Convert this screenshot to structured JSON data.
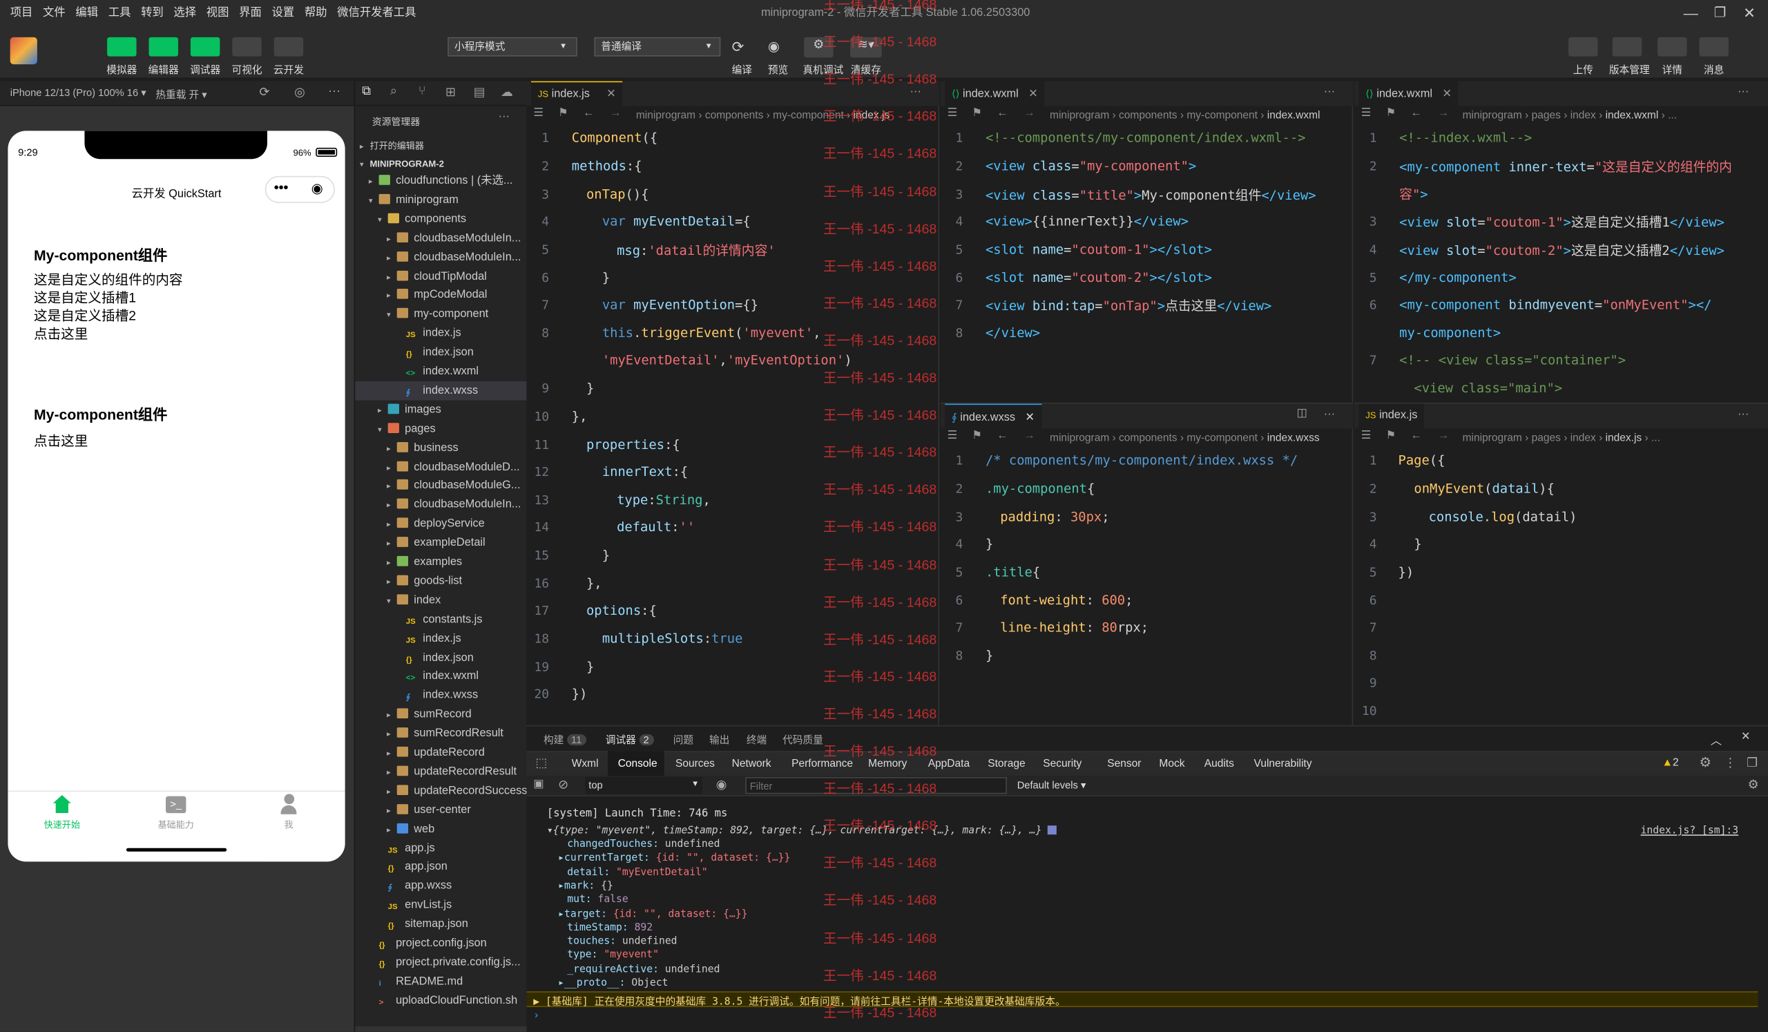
{
  "menu": [
    "项目",
    "文件",
    "编辑",
    "工具",
    "转到",
    "选择",
    "视图",
    "界面",
    "设置",
    "帮助",
    "微信开发者工具"
  ],
  "window_title": "miniprogram-2 - 微信开发者工具 Stable 1.06.2503300",
  "toolbar": {
    "left_buttons": [
      "模拟器",
      "编辑器",
      "调试器",
      "可视化",
      "云开发"
    ],
    "mode_select": "小程序模式",
    "compile_select": "普通编译",
    "mid_buttons": [
      "编译",
      "预览",
      "真机调试",
      "清缓存"
    ],
    "right_buttons": [
      "上传",
      "版本管理",
      "详情",
      "消息"
    ]
  },
  "simbar": {
    "device": "iPhone 12/13 (Pro) 100% 16 ▾",
    "hotreload": "热重载 开 ▾"
  },
  "phone": {
    "time": "9:29",
    "battery": "96%",
    "nav_title": "云开发 QuickStart",
    "block1_title": "My-component组件",
    "block1_lines": [
      "这是自定义的组件的内容",
      "这是自定义插槽1",
      "这是自定义插槽2",
      "点击这里"
    ],
    "block2_title": "My-component组件",
    "block2_lines": [
      "点击这里"
    ],
    "tabbar": [
      "快速开始",
      "基础能力",
      "我"
    ]
  },
  "explorer": {
    "header": "资源管理器",
    "open_editors": "打开的编辑器",
    "project": "MINIPROGRAM-2",
    "items": [
      {
        "label": "cloudfunctions | (未选...",
        "depth": 1,
        "type": "folder-g",
        "exp": "c"
      },
      {
        "label": "miniprogram",
        "depth": 1,
        "type": "folder",
        "exp": "o"
      },
      {
        "label": "components",
        "depth": 2,
        "type": "folder-y",
        "exp": "o"
      },
      {
        "label": "cloudbaseModuleIn...",
        "depth": 3,
        "type": "folder",
        "exp": "c"
      },
      {
        "label": "cloudbaseModuleIn...",
        "depth": 3,
        "type": "folder",
        "exp": "c"
      },
      {
        "label": "cloudTipModal",
        "depth": 3,
        "type": "folder",
        "exp": "c"
      },
      {
        "label": "mpCodeModal",
        "depth": 3,
        "type": "folder",
        "exp": "c"
      },
      {
        "label": "my-component",
        "depth": 3,
        "type": "folder",
        "exp": "o"
      },
      {
        "label": "index.js",
        "depth": 4,
        "type": "js"
      },
      {
        "label": "index.json",
        "depth": 4,
        "type": "json"
      },
      {
        "label": "index.wxml",
        "depth": 4,
        "type": "wxml"
      },
      {
        "label": "index.wxss",
        "depth": 4,
        "type": "wxss",
        "sel": true
      },
      {
        "label": "images",
        "depth": 2,
        "type": "folder-img",
        "exp": "c"
      },
      {
        "label": "pages",
        "depth": 2,
        "type": "folder-r",
        "exp": "o"
      },
      {
        "label": "business",
        "depth": 3,
        "type": "folder",
        "exp": "c"
      },
      {
        "label": "cloudbaseModuleD...",
        "depth": 3,
        "type": "folder",
        "exp": "c"
      },
      {
        "label": "cloudbaseModuleG...",
        "depth": 3,
        "type": "folder",
        "exp": "c"
      },
      {
        "label": "cloudbaseModuleIn...",
        "depth": 3,
        "type": "folder",
        "exp": "c"
      },
      {
        "label": "deployService",
        "depth": 3,
        "type": "folder",
        "exp": "c"
      },
      {
        "label": "exampleDetail",
        "depth": 3,
        "type": "folder",
        "exp": "c"
      },
      {
        "label": "examples",
        "depth": 3,
        "type": "folder-g",
        "exp": "c"
      },
      {
        "label": "goods-list",
        "depth": 3,
        "type": "folder",
        "exp": "c"
      },
      {
        "label": "index",
        "depth": 3,
        "type": "folder",
        "exp": "o"
      },
      {
        "label": "constants.js",
        "depth": 4,
        "type": "js"
      },
      {
        "label": "index.js",
        "depth": 4,
        "type": "js"
      },
      {
        "label": "index.json",
        "depth": 4,
        "type": "json"
      },
      {
        "label": "index.wxml",
        "depth": 4,
        "type": "wxml"
      },
      {
        "label": "index.wxss",
        "depth": 4,
        "type": "wxss"
      },
      {
        "label": "sumRecord",
        "depth": 3,
        "type": "folder",
        "exp": "c"
      },
      {
        "label": "sumRecordResult",
        "depth": 3,
        "type": "folder",
        "exp": "c"
      },
      {
        "label": "updateRecord",
        "depth": 3,
        "type": "folder",
        "exp": "c"
      },
      {
        "label": "updateRecordResult",
        "depth": 3,
        "type": "folder",
        "exp": "c"
      },
      {
        "label": "updateRecordSuccess",
        "depth": 3,
        "type": "folder",
        "exp": "c"
      },
      {
        "label": "user-center",
        "depth": 3,
        "type": "folder",
        "exp": "c"
      },
      {
        "label": "web",
        "depth": 3,
        "type": "folder-b",
        "exp": "c"
      },
      {
        "label": "app.js",
        "depth": 2,
        "type": "js"
      },
      {
        "label": "app.json",
        "depth": 2,
        "type": "json"
      },
      {
        "label": "app.wxss",
        "depth": 2,
        "type": "wxss"
      },
      {
        "label": "envList.js",
        "depth": 2,
        "type": "js"
      },
      {
        "label": "sitemap.json",
        "depth": 2,
        "type": "json"
      },
      {
        "label": "project.config.json",
        "depth": 1,
        "type": "json"
      },
      {
        "label": "project.private.config.js...",
        "depth": 1,
        "type": "json"
      },
      {
        "label": "README.md",
        "depth": 1,
        "type": "md"
      },
      {
        "label": "uploadCloudFunction.sh",
        "depth": 1,
        "type": "sh"
      }
    ]
  },
  "editors": {
    "e1": {
      "tab": "index.js",
      "crumb": [
        "miniprogram",
        "components",
        "my-component",
        "index.js"
      ]
    },
    "e2": {
      "tab": "index.wxml",
      "crumb": [
        "miniprogram",
        "components",
        "my-component",
        "index.wxml"
      ]
    },
    "e3": {
      "tab": "index.wxml",
      "crumb": [
        "miniprogram",
        "pages",
        "index",
        "index.wxml",
        "..."
      ]
    },
    "e4": {
      "tab": "index.wxss",
      "crumb": [
        "miniprogram",
        "components",
        "my-component",
        "index.wxss"
      ]
    },
    "e5": {
      "tab": "index.js",
      "crumb": [
        "miniprogram",
        "pages",
        "index",
        "index.js",
        "..."
      ]
    }
  },
  "watermark": "王一伟 -145 - 1468",
  "bottom": {
    "top_tabs": [
      "构建",
      "调试器",
      "问题",
      "输出",
      "终端",
      "代码质量"
    ],
    "build_count": "11",
    "debug_count": "2",
    "devtabs": [
      "Wxml",
      "Console",
      "Sources",
      "Network",
      "Performance",
      "Memory",
      "AppData",
      "Storage",
      "Security",
      "Sensor",
      "Mock",
      "Audits",
      "Vulnerability"
    ],
    "warn_count": "2",
    "context": "top",
    "filter_placeholder": "Filter",
    "levels": "Default levels ▾",
    "log_launch": "[system] Launch Time: 746 ms",
    "log_obj": "▾{type: \"myevent\", timeStamp: 892, target: {…}, currentTarget: {…}, mark: {…}, …}",
    "log_src": "index.js? [sm]:3",
    "log_fields": [
      "changedTouches: undefined",
      "▸currentTarget: {id: \"\", dataset: {…}}",
      "detail: \"myEventDetail\"",
      "▸mark: {}",
      "mut: false",
      "▸target: {id: \"\", dataset: {…}}",
      "timeStamp: 892",
      "touches: undefined",
      "type: \"myevent\"",
      "_requireActive: undefined",
      "▸__proto__: Object"
    ],
    "warn_line": "▶ [基础库] 正在使用灰度中的基础库 3.8.5 进行调试。如有问题，请前往工具栏-详情-本地设置更改基础库版本。"
  }
}
